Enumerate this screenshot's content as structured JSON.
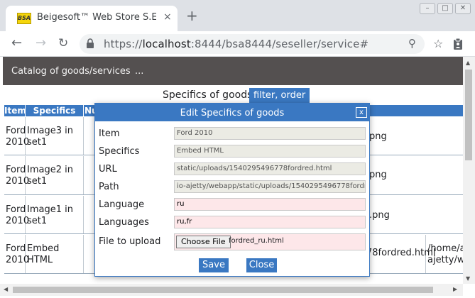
{
  "browser": {
    "tab_title": "Beigesoft™ Web Store S.E.",
    "favicon_text": "BSA",
    "tab_close": "×",
    "new_tab": "+",
    "url_host": "localhost",
    "url_prefix": "https://",
    "url_rest": ":8444/bsa8444/seseller/service#",
    "win_minimize": "–",
    "win_maximize": "□",
    "win_close": "✕"
  },
  "appbar": {
    "menu_label": "Catalog of goods/services",
    "more_label": "..."
  },
  "filterbar": {
    "title": "Specifics of goods",
    "filter_button": "filter, order"
  },
  "table": {
    "headers": [
      "Item",
      "Specifics",
      "Nu"
    ],
    "rows": [
      {
        "item": "Ford 2010",
        "specifics": "Image3 in set1",
        "tail": "png",
        "path": ""
      },
      {
        "item": "Ford 2010",
        "specifics": "Image2 in set1",
        "tail": "png",
        "path": ""
      },
      {
        "item": "Ford 2010",
        "specifics": "Image1 in set1",
        "tail": ".png",
        "path": ""
      },
      {
        "item": "Ford 2010",
        "specifics": "Embed HTML",
        "tail": "78fordred.html",
        "path": "/home/a ajetty/we"
      }
    ]
  },
  "dialog": {
    "title": "Edit Specifics of goods",
    "close": "x",
    "fields": {
      "item": {
        "label": "Item",
        "value": "Ford 2010"
      },
      "specifics": {
        "label": "Specifics",
        "value": "Embed HTML"
      },
      "url": {
        "label": "URL",
        "value": "static/uploads/1540295496778fordred.html"
      },
      "path": {
        "label": "Path",
        "value": "io-ajetty/webapp/static/uploads/1540295496778fordred"
      },
      "language": {
        "label": "Language",
        "value": "ru"
      },
      "languages": {
        "label": "Languages",
        "value": "ru,fr"
      },
      "file": {
        "label": "File to upload",
        "button": "Choose File",
        "filename": "fordred_ru.html"
      }
    },
    "save_label": "Save",
    "close_label": "Close"
  },
  "colors": {
    "accent": "#3a78c2",
    "appbar": "#545050",
    "editable_field": "#fde7e9",
    "readonly_field": "#ebebe4"
  }
}
